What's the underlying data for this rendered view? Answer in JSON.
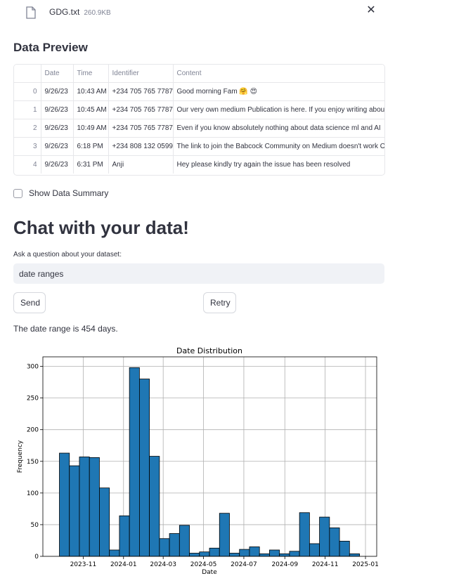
{
  "file": {
    "name": "GDG.txt",
    "size": "260.9KB"
  },
  "icons": {
    "file": "file-icon",
    "close": "close-icon"
  },
  "preview": {
    "title": "Data Preview",
    "columns": [
      "",
      "Date",
      "Time",
      "Identifier",
      "Content"
    ],
    "rows": [
      [
        "0",
        "9/26/23",
        "10:43 AM",
        "+234 705 765 7787",
        "Good morning Fam 🤗 😍"
      ],
      [
        "1",
        "9/26/23",
        "10:45 AM",
        "+234 705 765 7787",
        "Our very own medium Publication is here.  If you enjoy writing abou"
      ],
      [
        "2",
        "9/26/23",
        "10:49 AM",
        "+234 705 765 7787",
        "Even if you know absolutely nothing about data science  ml  and AI"
      ],
      [
        "3",
        "9/26/23",
        "6:18 PM",
        "+234 808 132 0599",
        "The link to join the Babcock Community on Medium doesn't work O"
      ],
      [
        "4",
        "9/26/23",
        "6:31 PM",
        "Anji",
        "Hey please kindly try again  the issue has been resolved"
      ]
    ]
  },
  "summary_checkbox": {
    "label": "Show Data Summary",
    "checked": false
  },
  "chat": {
    "title": "Chat with your data!",
    "question_label": "Ask a question about your dataset:",
    "question_value": "date ranges",
    "send_label": "Send",
    "retry_label": "Retry",
    "answer": "The date range is 454 days."
  },
  "chart_data": {
    "type": "bar",
    "title": "Date Distribution",
    "xlabel": "Date",
    "ylabel": "Frequency",
    "bar_color": "#1f77b4",
    "grid": true,
    "x_start": "2023-09-26",
    "x_end": "2024-12-23",
    "xlim": [
      "2023-09-01",
      "2025-01-18"
    ],
    "ylim": [
      0,
      315
    ],
    "yticks": [
      0,
      50,
      100,
      150,
      200,
      250,
      300
    ],
    "xticks": [
      {
        "date": "2023-11-01",
        "label": "2023-11"
      },
      {
        "date": "2024-01-01",
        "label": "2024-01"
      },
      {
        "date": "2024-03-01",
        "label": "2024-03"
      },
      {
        "date": "2024-05-01",
        "label": "2024-05"
      },
      {
        "date": "2024-07-01",
        "label": "2024-07"
      },
      {
        "date": "2024-09-01",
        "label": "2024-09"
      },
      {
        "date": "2024-11-01",
        "label": "2024-11"
      },
      {
        "date": "2025-01-01",
        "label": "2025-01"
      }
    ],
    "values": [
      163,
      143,
      157,
      156,
      108,
      10,
      64,
      298,
      280,
      158,
      28,
      36,
      49,
      5,
      7,
      13,
      68,
      5,
      11,
      15,
      4,
      10,
      4,
      8,
      69,
      20,
      62,
      45,
      24,
      4
    ]
  }
}
